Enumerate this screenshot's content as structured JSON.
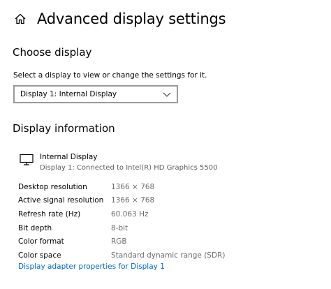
{
  "header": {
    "title": "Advanced display settings",
    "home_icon": "home-icon"
  },
  "choose_display": {
    "title": "Choose display",
    "instruction": "Select a display to view or change the settings for it.",
    "selected": "Display 1: Internal Display"
  },
  "display_information": {
    "title": "Display information",
    "display_icon": "monitor-icon",
    "display_name": "Internal Display",
    "connection": "Display 1: Connected to Intel(R) HD Graphics 5500",
    "rows": [
      {
        "key": "Desktop resolution",
        "value": "1366 × 768"
      },
      {
        "key": "Active signal resolution",
        "value": "1366 × 768"
      },
      {
        "key": "Refresh rate (Hz)",
        "value": "60.063 Hz"
      },
      {
        "key": "Bit depth",
        "value": "8-bit"
      },
      {
        "key": "Color format",
        "value": "RGB"
      },
      {
        "key": "Color space",
        "value": "Standard dynamic range (SDR)"
      }
    ],
    "adapter_link": "Display adapter properties for Display 1"
  },
  "colors": {
    "link": "#0067c0",
    "secondary_text": "#6b6b6b",
    "dropdown_border": "#999999"
  }
}
